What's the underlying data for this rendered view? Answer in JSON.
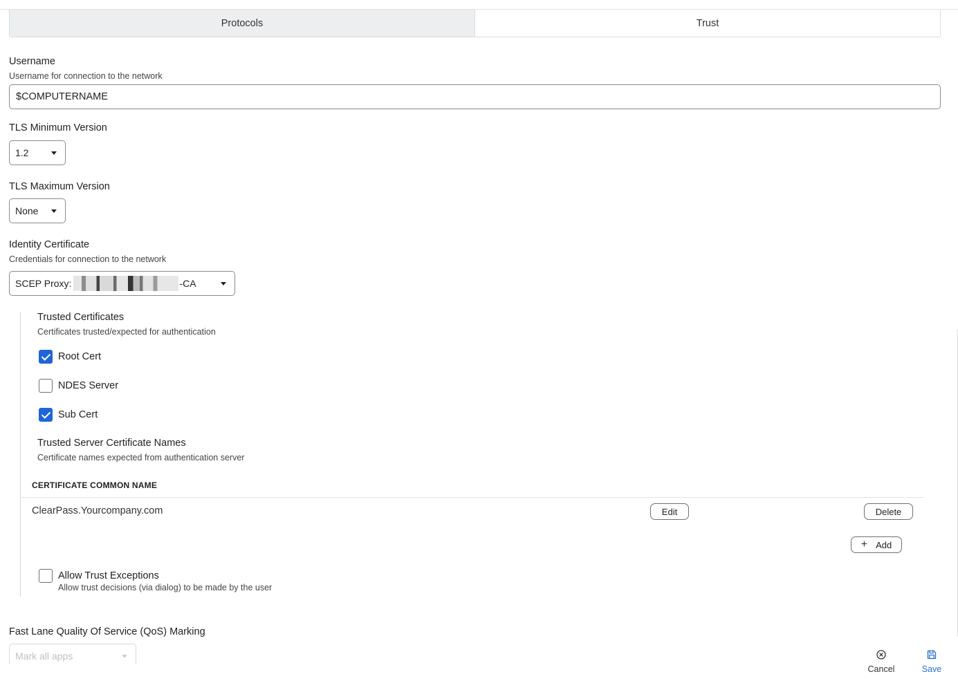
{
  "tabs": [
    {
      "label": "Protocols",
      "active": true
    },
    {
      "label": "Trust",
      "active": false
    }
  ],
  "username": {
    "label": "Username",
    "description": "Username for connection to the network",
    "value": "$COMPUTERNAME"
  },
  "tls_min": {
    "label": "TLS Minimum Version",
    "selected": "1.2"
  },
  "tls_max": {
    "label": "TLS Maximum Version",
    "selected": "None"
  },
  "identity_certificate": {
    "label": "Identity Certificate",
    "description": "Credentials for connection to the network",
    "selected_prefix": "SCEP Proxy:",
    "selected_suffix": "-CA"
  },
  "trusted_certificates": {
    "label": "Trusted Certificates",
    "description": "Certificates trusted/expected for authentication",
    "items": [
      {
        "label": "Root Cert",
        "checked": true
      },
      {
        "label": "NDES Server",
        "checked": false
      },
      {
        "label": "Sub Cert",
        "checked": true
      }
    ]
  },
  "trusted_server_names": {
    "label": "Trusted Server Certificate Names",
    "description": "Certificate names expected from authentication server",
    "column_header": "CERTIFICATE COMMON NAME",
    "rows": [
      {
        "name": "ClearPass.Yourcompany.com",
        "edit_label": "Edit",
        "delete_label": "Delete"
      }
    ],
    "add_label": "Add"
  },
  "allow_trust_exceptions": {
    "label": "Allow Trust Exceptions",
    "description": "Allow trust decisions (via dialog) to be made by the user",
    "checked": false
  },
  "fast_lane": {
    "label": "Fast Lane Quality Of Service (QoS) Marking",
    "placeholder": "Mark all apps"
  },
  "footer": {
    "cancel_label": "Cancel",
    "save_label": "Save"
  },
  "colors": {
    "accent": "#1f65d6",
    "save": "#2a6fcb"
  }
}
